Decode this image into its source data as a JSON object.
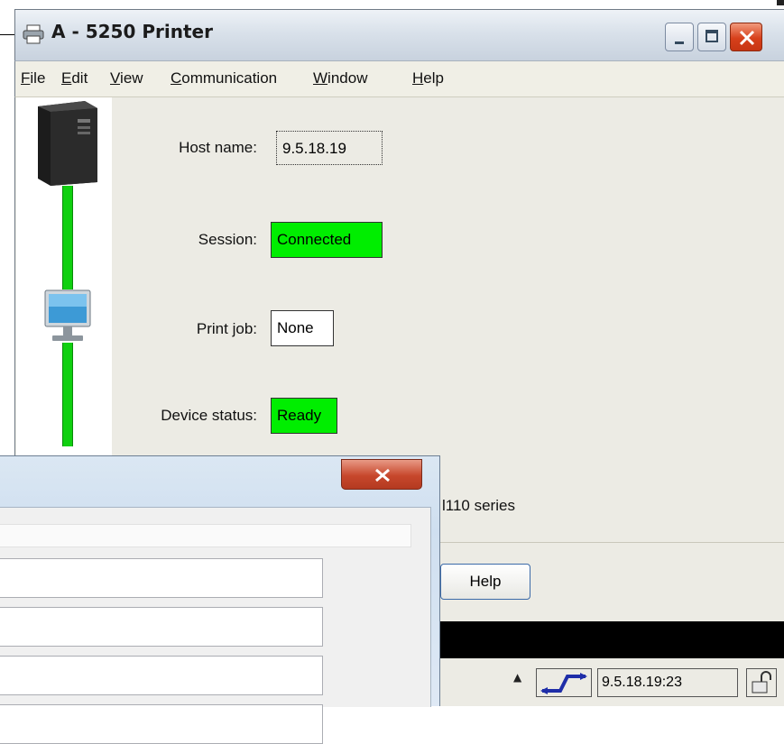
{
  "window": {
    "title": "A - 5250 Printer",
    "icon": "printer-icon"
  },
  "menu": {
    "items": [
      "File",
      "Edit",
      "View",
      "Communication",
      "Window",
      "Help"
    ],
    "mnemonics": [
      "F",
      "E",
      "V",
      "C",
      "W",
      "H"
    ]
  },
  "fields": {
    "host_label": "Host name:",
    "host_value": "9.5.18.19",
    "session_label": "Session:",
    "session_value": "Connected",
    "printjob_label": "Print job:",
    "printjob_value": "None",
    "device_label": "Device status:",
    "device_value": "Ready",
    "printer_partial": "l110 series"
  },
  "buttons": {
    "help": "Help"
  },
  "status_bar": {
    "host_time": "9.5.18.19:23",
    "arrow": "▲"
  },
  "colors": {
    "status_green": "#00ee00",
    "line_green": "#10d010",
    "close_red": "#d7401b"
  },
  "icons": [
    "printer-icon",
    "server-tower-icon",
    "monitor-icon",
    "connection-icon",
    "lock-icon",
    "close-icon"
  ]
}
